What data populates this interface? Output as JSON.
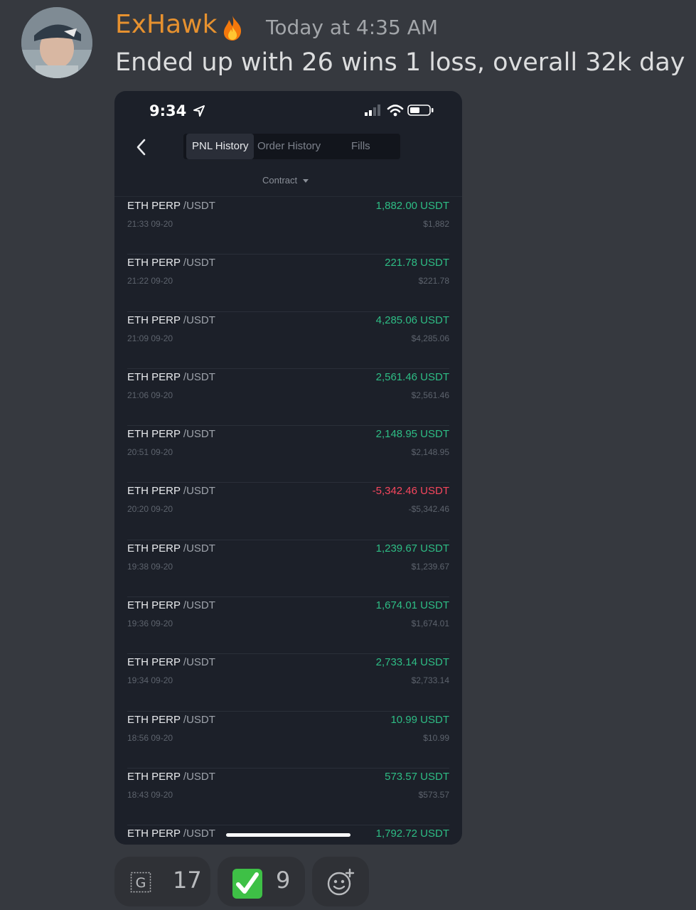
{
  "message": {
    "username": "ExHawk",
    "timestamp": "Today at 4:35 AM",
    "text": "Ended up with 26 wins 1 loss, overall 32k day"
  },
  "phone": {
    "status_time": "9:34",
    "tabs": [
      {
        "label": "PNL History",
        "active": true
      },
      {
        "label": "Order History",
        "active": false
      },
      {
        "label": "Fills",
        "active": false
      }
    ],
    "filter_label": "Contract",
    "rows": [
      {
        "symbol": "ETH PERP",
        "quote": "/USDT",
        "time": "21:33 09-20",
        "amount": "1,882.00 USDT",
        "usd": "$1,882",
        "negative": false
      },
      {
        "symbol": "ETH PERP",
        "quote": "/USDT",
        "time": "21:22 09-20",
        "amount": "221.78 USDT",
        "usd": "$221.78",
        "negative": false
      },
      {
        "symbol": "ETH PERP",
        "quote": "/USDT",
        "time": "21:09 09-20",
        "amount": "4,285.06 USDT",
        "usd": "$4,285.06",
        "negative": false
      },
      {
        "symbol": "ETH PERP",
        "quote": "/USDT",
        "time": "21:06 09-20",
        "amount": "2,561.46 USDT",
        "usd": "$2,561.46",
        "negative": false
      },
      {
        "symbol": "ETH PERP",
        "quote": "/USDT",
        "time": "20:51 09-20",
        "amount": "2,148.95 USDT",
        "usd": "$2,148.95",
        "negative": false
      },
      {
        "symbol": "ETH PERP",
        "quote": "/USDT",
        "time": "20:20 09-20",
        "amount": "-5,342.46 USDT",
        "usd": "-$5,342.46",
        "negative": true
      },
      {
        "symbol": "ETH PERP",
        "quote": "/USDT",
        "time": "19:38 09-20",
        "amount": "1,239.67 USDT",
        "usd": "$1,239.67",
        "negative": false
      },
      {
        "symbol": "ETH PERP",
        "quote": "/USDT",
        "time": "19:36 09-20",
        "amount": "1,674.01 USDT",
        "usd": "$1,674.01",
        "negative": false
      },
      {
        "symbol": "ETH PERP",
        "quote": "/USDT",
        "time": "19:34 09-20",
        "amount": "2,733.14 USDT",
        "usd": "$2,733.14",
        "negative": false
      },
      {
        "symbol": "ETH PERP",
        "quote": "/USDT",
        "time": "18:56 09-20",
        "amount": "10.99 USDT",
        "usd": "$10.99",
        "negative": false
      },
      {
        "symbol": "ETH PERP",
        "quote": "/USDT",
        "time": "18:43 09-20",
        "amount": "573.57 USDT",
        "usd": "$573.57",
        "negative": false
      },
      {
        "symbol": "ETH PERP",
        "quote": "/USDT",
        "time": "",
        "amount": "1,792.72 USDT",
        "usd": "",
        "negative": false
      }
    ]
  },
  "reactions": [
    {
      "icon": "g-emote-icon",
      "glyph": "G",
      "count": "17"
    },
    {
      "icon": "check-mark-icon",
      "count": "9"
    },
    {
      "icon": "add-reaction-icon"
    }
  ],
  "colors": {
    "username": "#e6912f",
    "positive": "#2ebd85",
    "negative": "#f6465d"
  }
}
